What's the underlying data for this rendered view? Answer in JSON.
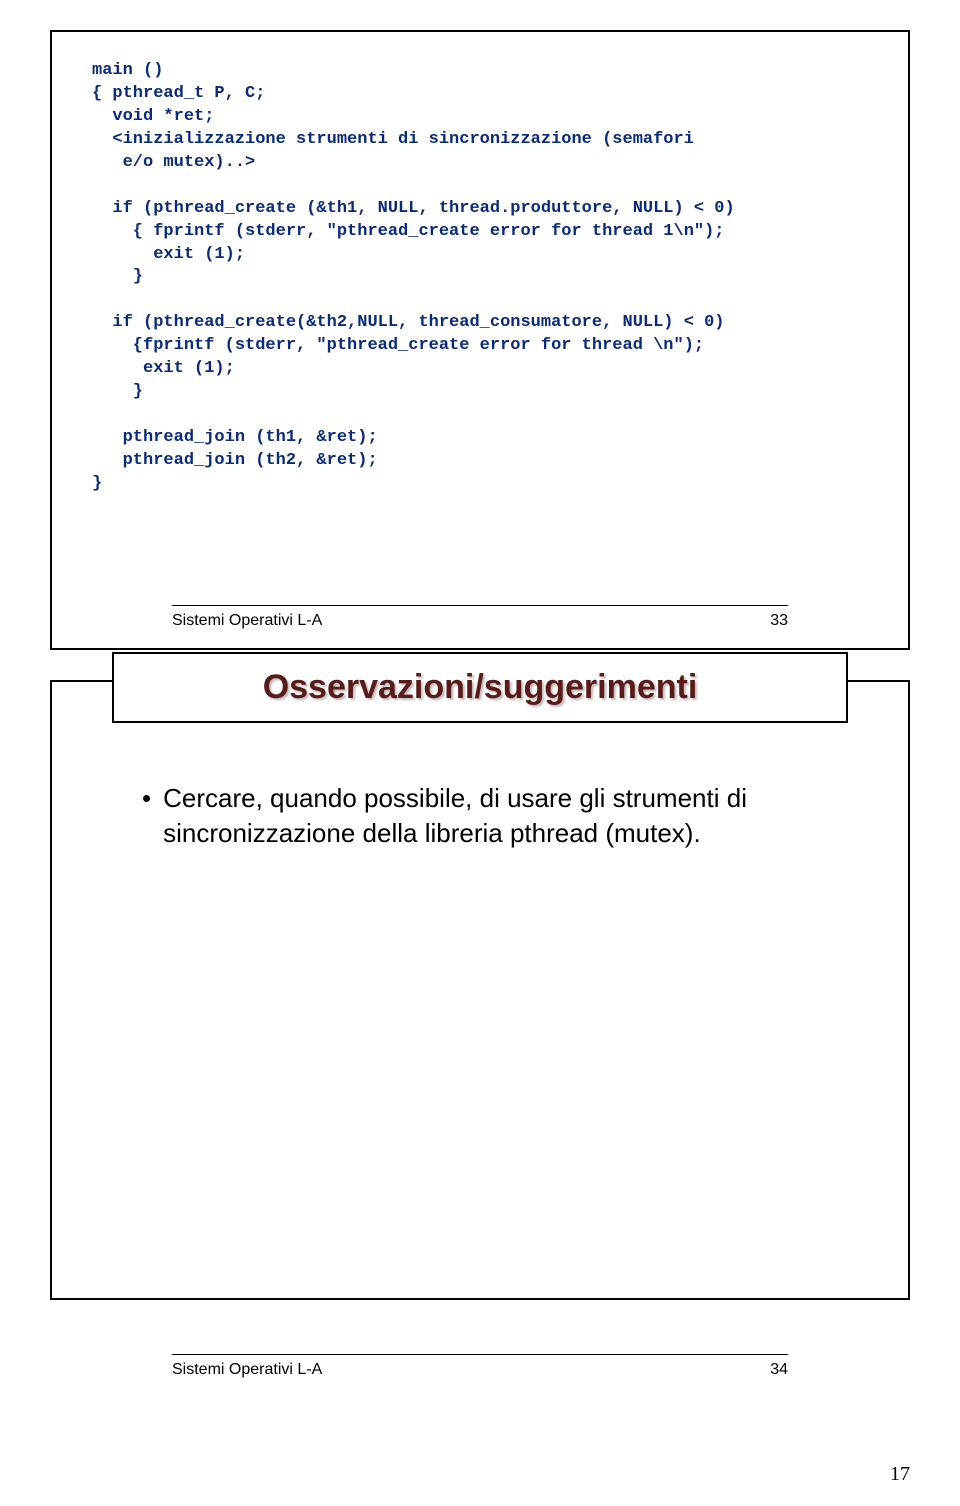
{
  "slide1": {
    "code": "main ()\n{ pthread_t P, C;\n  void *ret;\n  <inizializzazione strumenti di sincronizzazione (semafori\n   e/o mutex)..>\n\n  if (pthread_create (&th1, NULL, thread.produttore, NULL) < 0)\n    { fprintf (stderr, \"pthread_create error for thread 1\\n\");\n      exit (1);\n    }\n\n  if (pthread_create(&th2,NULL, thread_consumatore, NULL) < 0)\n    {fprintf (stderr, \"pthread_create error for thread \\n\");\n     exit (1);\n    }\n\n   pthread_join (th1, &ret);\n   pthread_join (th2, &ret);\n}",
    "footer_label": "Sistemi Operativi L-A",
    "footer_num": "33"
  },
  "slide2": {
    "title": "Osservazioni/suggerimenti",
    "bullet": "Cercare, quando possibile, di usare gli strumenti di sincronizzazione della libreria pthread (mutex).",
    "footer_label": "Sistemi Operativi L-A",
    "footer_num": "34"
  },
  "page_number": "17"
}
